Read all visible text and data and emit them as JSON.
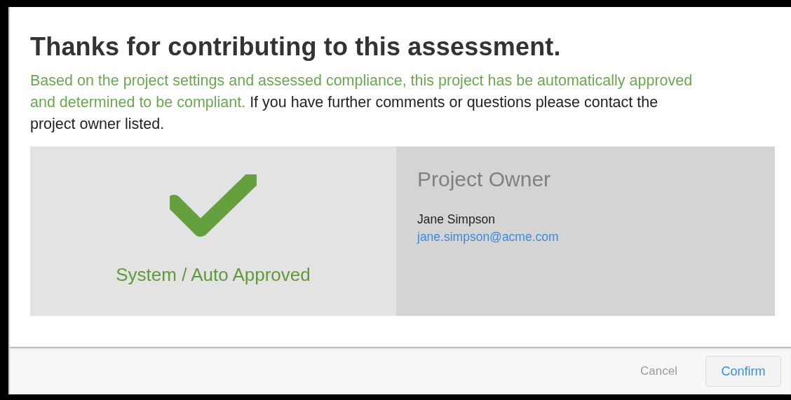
{
  "dialog": {
    "title": "Thanks for contributing to this assessment.",
    "message": {
      "highlighted": "Based on the project settings and assessed compliance, this project has be automatically approved and determined to be compliant.",
      "text": " If you have further comments or questions please contact the project owner listed."
    },
    "status": {
      "label": "System / Auto Approved",
      "approved": true
    },
    "owner": {
      "heading": "Project Owner",
      "name": "Jane Simpson",
      "email": "jane.simpson@acme.com"
    },
    "buttons": [
      {
        "label": "Cancel",
        "kind": "link"
      },
      {
        "label": "Confirm",
        "kind": "primary"
      }
    ]
  }
}
